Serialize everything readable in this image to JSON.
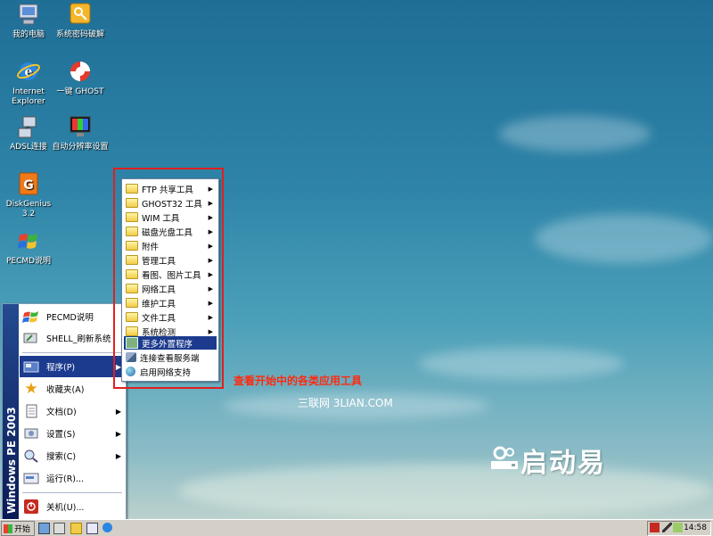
{
  "desktop": {
    "icons": [
      {
        "label": "我的电脑",
        "icon": "computer-icon"
      },
      {
        "label": "系统密码破解",
        "icon": "key-icon"
      },
      {
        "label": "Internet Explorer",
        "icon": "ie-icon"
      },
      {
        "label": "一键 GHOST",
        "icon": "lifebuoy-icon"
      },
      {
        "label": "ADSL连接",
        "icon": "network-icon"
      },
      {
        "label": "自动分辨率设置",
        "icon": "display-icon"
      },
      {
        "label": "DiskGenius 3.2",
        "icon": "diskgenius-icon"
      },
      {
        "label": "PECMD说明",
        "icon": "windows-flag-icon"
      }
    ]
  },
  "start_menu": {
    "banner": "Windows PE 2003",
    "pinned": [
      {
        "label": "PECMD说明",
        "icon": "windows-flag-icon"
      },
      {
        "label": "SHELL_刷新系统",
        "icon": "refresh-icon"
      }
    ],
    "items": [
      {
        "label": "程序(P)",
        "icon": "programs-icon",
        "has_submenu": true
      },
      {
        "label": "收藏夹(A)",
        "icon": "star-icon",
        "has_submenu": false
      },
      {
        "label": "文档(D)",
        "icon": "documents-icon",
        "has_submenu": true
      },
      {
        "label": "设置(S)",
        "icon": "settings-icon",
        "has_submenu": true
      },
      {
        "label": "搜索(C)",
        "icon": "search-icon",
        "has_submenu": true
      },
      {
        "label": "运行(R)...",
        "icon": "run-icon",
        "has_submenu": false
      }
    ],
    "shutdown_label": "关机(U)..."
  },
  "submenu": {
    "items": [
      {
        "label": "FTP 共享工具",
        "has_submenu": true
      },
      {
        "label": "GHOST32 工具",
        "has_submenu": true
      },
      {
        "label": "WIM 工具",
        "has_submenu": true
      },
      {
        "label": "磁盘光盘工具",
        "has_submenu": true
      },
      {
        "label": "附件",
        "has_submenu": true
      },
      {
        "label": "管理工具",
        "has_submenu": true
      },
      {
        "label": "看图、图片工具",
        "has_submenu": true
      },
      {
        "label": "网络工具",
        "has_submenu": true
      },
      {
        "label": "维护工具",
        "has_submenu": true
      },
      {
        "label": "文件工具",
        "has_submenu": true
      },
      {
        "label": "系统检测",
        "has_submenu": true
      },
      {
        "label": "更多外置程序",
        "has_submenu": false
      },
      {
        "label": "连接查看服务端",
        "has_submenu": false
      },
      {
        "label": "启用网络支持",
        "has_submenu": false
      }
    ]
  },
  "annotation": "查看开始中的各类应用工具",
  "watermark": "三联网 3LIAN.COM",
  "logo_text": "启动易",
  "taskbar": {
    "start_label": "开始",
    "clock": "14:58"
  },
  "colors": {
    "highlight": "#e02020",
    "menu_selection": "#1c3b8e"
  }
}
